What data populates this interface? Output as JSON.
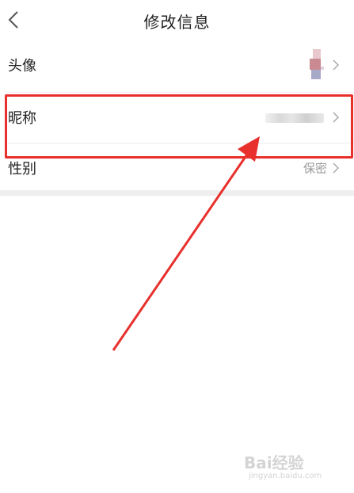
{
  "header": {
    "title": "修改信息"
  },
  "rows": {
    "avatar": {
      "label": "头像"
    },
    "nickname": {
      "label": "昵称"
    },
    "gender": {
      "label": "性别",
      "value": "保密"
    }
  },
  "watermark": {
    "logo_text": "Bai经验",
    "url": "jingyan.baidu.com"
  },
  "colors": {
    "highlight": "#e8302c",
    "arrow": "#e8302c",
    "text": "#222222",
    "muted": "#999999",
    "divider": "#ececec"
  },
  "icons": {
    "back": "chevron-left-icon",
    "row_chevron": "chevron-right-icon"
  }
}
